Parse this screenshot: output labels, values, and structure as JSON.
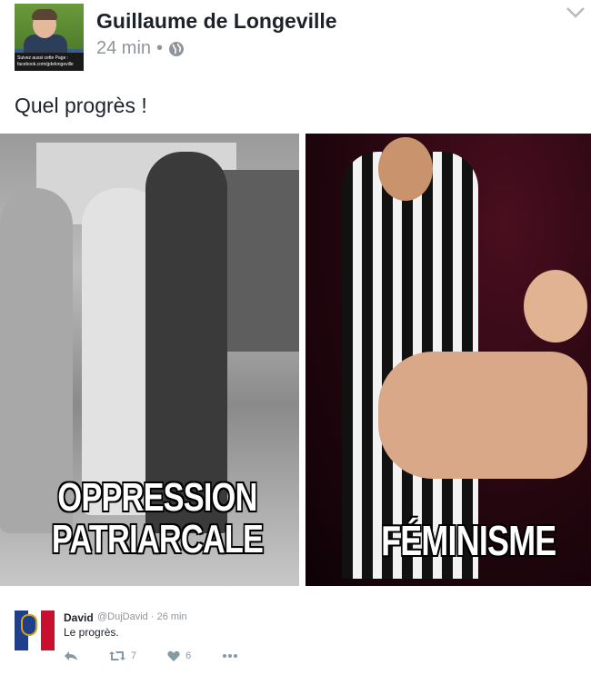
{
  "post": {
    "author": "Guillaume de Longeville",
    "time": "24 min",
    "separator": "•",
    "text": "Quel progrès !",
    "avatar_banner": "Suivez aussi cette Page : facebook.com/gdelongeville"
  },
  "meme": {
    "left_caption_line1": "OPPRESSION",
    "left_caption_line2": "PATRIARCALE",
    "right_caption": "FÉMINISME"
  },
  "comment": {
    "name": "David",
    "handle": "@DujDavid · 26 min",
    "text": "Le progrès.",
    "retweets": "7",
    "likes": "6"
  },
  "icons": {
    "privacy": "globe-icon",
    "options": "chevron-down-icon",
    "reply": "reply-icon",
    "retweet": "retweet-icon",
    "like": "heart-icon",
    "more": "more-icon"
  },
  "colors": {
    "name_text": "#1d2129",
    "meta_gray": "#90949c",
    "tweet_action_gray": "#8899a6"
  }
}
